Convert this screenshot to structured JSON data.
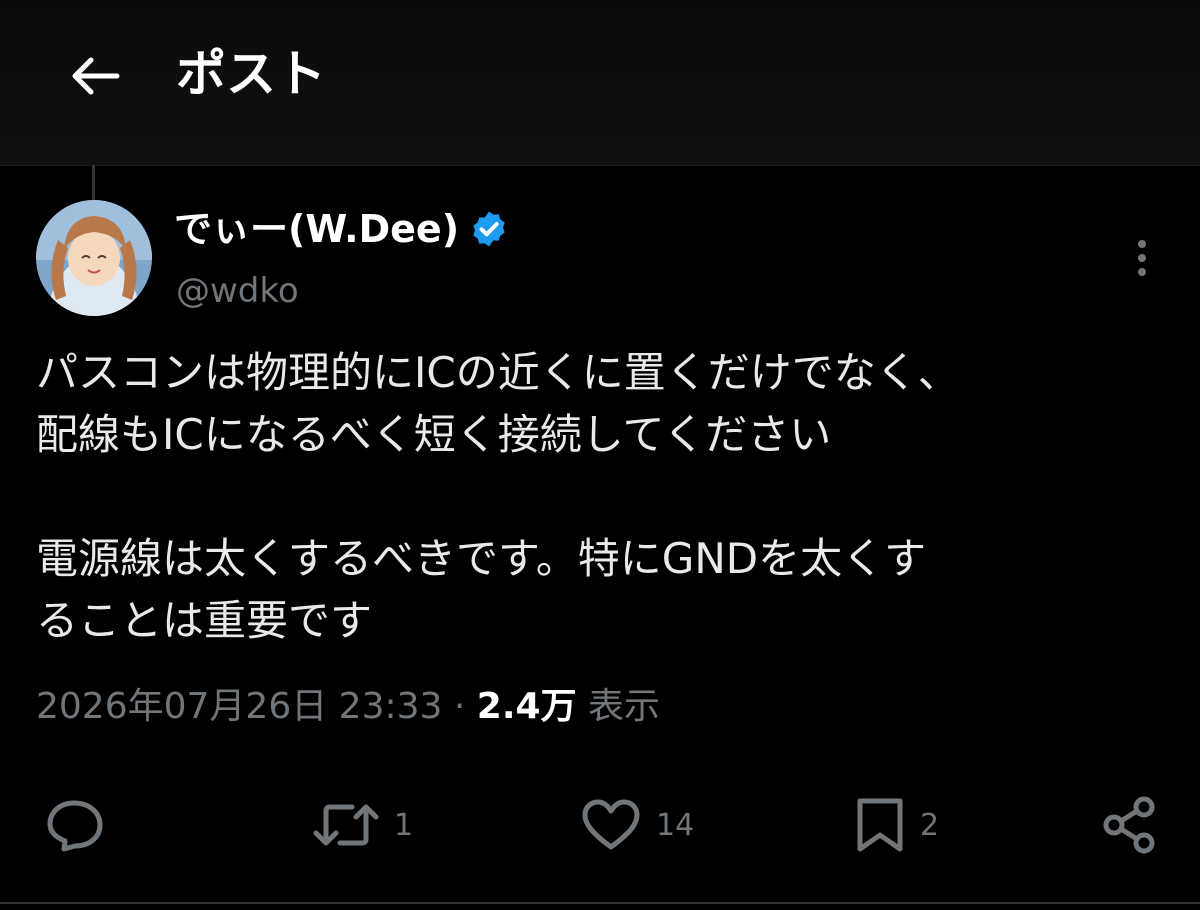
{
  "header": {
    "title": "ポスト",
    "back_icon": "arrow-left-icon"
  },
  "author": {
    "display_name": "でぃー(W.Dee)",
    "handle": "@wdko",
    "verified_icon": "verified-badge-icon",
    "verified_color": "#1d9bf0"
  },
  "post": {
    "lines_p1": [
      "パスコンは物理的にICの近くに置くだけでなく、",
      "配線もICになるべく短く接続してください"
    ],
    "lines_p2": [
      "電源線は太くするべきです。特にGNDを太くす",
      "ることは重要です"
    ],
    "timestamp": "2026年07月26日 23:33",
    "separator": "·",
    "views_count": "2.4万",
    "views_label": "表示"
  },
  "actions": {
    "reply_icon": "reply-icon",
    "repost_icon": "repost-icon",
    "repost_count": "1",
    "like_icon": "heart-icon",
    "like_count": "14",
    "bookmark_icon": "bookmark-icon",
    "bookmark_count": "2",
    "share_icon": "share-icon"
  },
  "colors": {
    "background": "#000000",
    "text": "#e7e9ea",
    "secondary": "#71767b",
    "accent": "#1d9bf0"
  }
}
